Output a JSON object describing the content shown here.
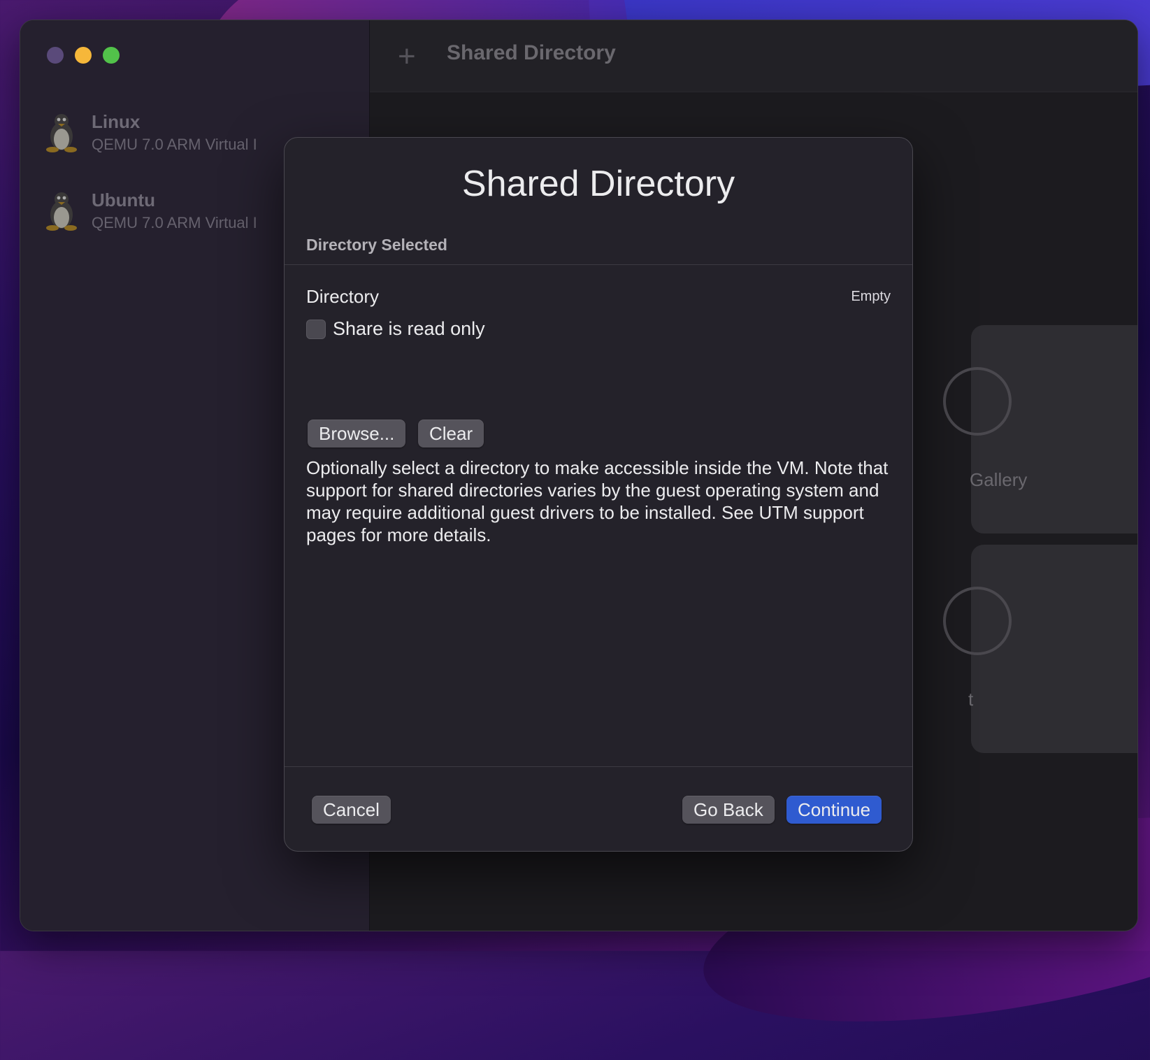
{
  "sidebar": {
    "items": [
      {
        "name": "Linux",
        "subtitle": "QEMU 7.0 ARM Virtual I"
      },
      {
        "name": "Ubuntu",
        "subtitle": "QEMU 7.0 ARM Virtual I"
      }
    ]
  },
  "toolbar": {
    "title": "Shared Directory",
    "add_icon": "plus-icon"
  },
  "background_cards": [
    {
      "label": "Gallery"
    },
    {
      "label": "t"
    }
  ],
  "dialog": {
    "title": "Shared Directory",
    "section_header": "Directory Selected",
    "directory_label": "Directory",
    "directory_value": "Empty",
    "read_only_label": "Share is read only",
    "read_only_checked": false,
    "browse_label": "Browse...",
    "clear_label": "Clear",
    "description": "Optionally select a directory to make accessible inside the VM. Note that support for shared directories varies by the guest operating system and may require additional guest drivers to be installed. See UTM support pages for more details.",
    "cancel_label": "Cancel",
    "go_back_label": "Go Back",
    "continue_label": "Continue"
  },
  "colors": {
    "accent": "#2f5bd0",
    "traffic_close": "#5a4a7a",
    "traffic_minimize": "#f6b73a",
    "traffic_maximize": "#52c24a"
  }
}
